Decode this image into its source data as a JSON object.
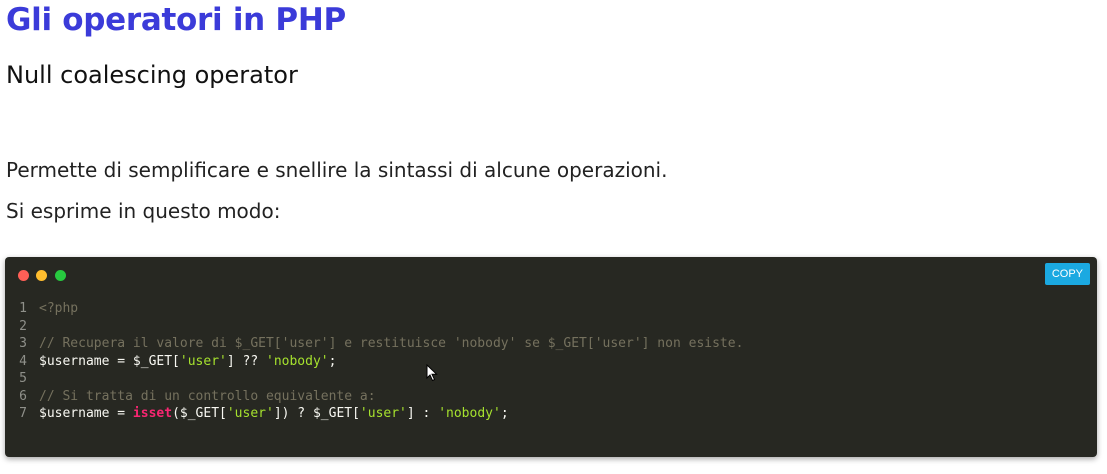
{
  "page": {
    "title": "Gli operatori in PHP",
    "subtitle": "Null coalescing operator",
    "paragraphs": [
      "Permette di semplificare e snellire la sintassi di alcune operazioni.",
      "Si esprime in questo modo:"
    ]
  },
  "code_block": {
    "copy_label": "COPY",
    "window_dots": [
      {
        "name": "close",
        "color": "#ff5f56"
      },
      {
        "name": "minimize",
        "color": "#ffbd2e"
      },
      {
        "name": "maximize",
        "color": "#27c93f"
      }
    ],
    "lines": [
      {
        "number": "1",
        "tokens": [
          {
            "text": "<?php",
            "type": "php"
          }
        ]
      },
      {
        "number": "2",
        "tokens": []
      },
      {
        "number": "3",
        "tokens": [
          {
            "text": "// Recupera il valore di $_GET['user'] e restituisce 'nobody' se $_GET['user'] non esiste.",
            "type": "comment"
          }
        ]
      },
      {
        "number": "4",
        "tokens": [
          {
            "text": "$username = $_GET[",
            "type": "plain"
          },
          {
            "text": "'user'",
            "type": "str"
          },
          {
            "text": "] ?? ",
            "type": "plain"
          },
          {
            "text": "'nobody'",
            "type": "str"
          },
          {
            "text": ";",
            "type": "plain"
          }
        ]
      },
      {
        "number": "5",
        "tokens": []
      },
      {
        "number": "6",
        "tokens": [
          {
            "text": "// Si tratta di un controllo equivalente a:",
            "type": "comment"
          }
        ]
      },
      {
        "number": "7",
        "tokens": [
          {
            "text": "$username = ",
            "type": "plain"
          },
          {
            "text": "isset",
            "type": "fn"
          },
          {
            "text": "($_GET[",
            "type": "plain"
          },
          {
            "text": "'user'",
            "type": "str"
          },
          {
            "text": "]) ? $_GET[",
            "type": "plain"
          },
          {
            "text": "'user'",
            "type": "str"
          },
          {
            "text": "] : ",
            "type": "plain"
          },
          {
            "text": "'nobody'",
            "type": "str"
          },
          {
            "text": ";",
            "type": "plain"
          }
        ]
      }
    ]
  },
  "icons": {
    "cursor": "mouse-pointer-icon"
  },
  "colors": {
    "title": "#3b3bd9",
    "code_background": "#272822",
    "copy_button": "#1ba9e1",
    "string": "#a6e22e",
    "keyword": "#f92672",
    "comment": "#75715e"
  }
}
